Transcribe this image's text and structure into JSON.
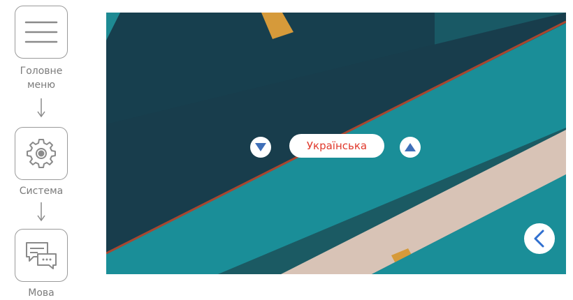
{
  "breadcrumb": {
    "items": [
      {
        "label": "Головне\nменю",
        "icon": "menu-icon"
      },
      {
        "label": "Система",
        "icon": "gear-icon"
      },
      {
        "label": "Мова",
        "icon": "chat-bubbles-icon"
      }
    ]
  },
  "selector": {
    "current_value": "Українська",
    "down_icon": "triangle-down-icon",
    "up_icon": "triangle-up-icon"
  },
  "back": {
    "icon": "chevron-left-icon"
  },
  "colors": {
    "accent_text": "#e0392c",
    "arrow_blue": "#3f6fb8",
    "back_blue": "#2f6fd0"
  }
}
